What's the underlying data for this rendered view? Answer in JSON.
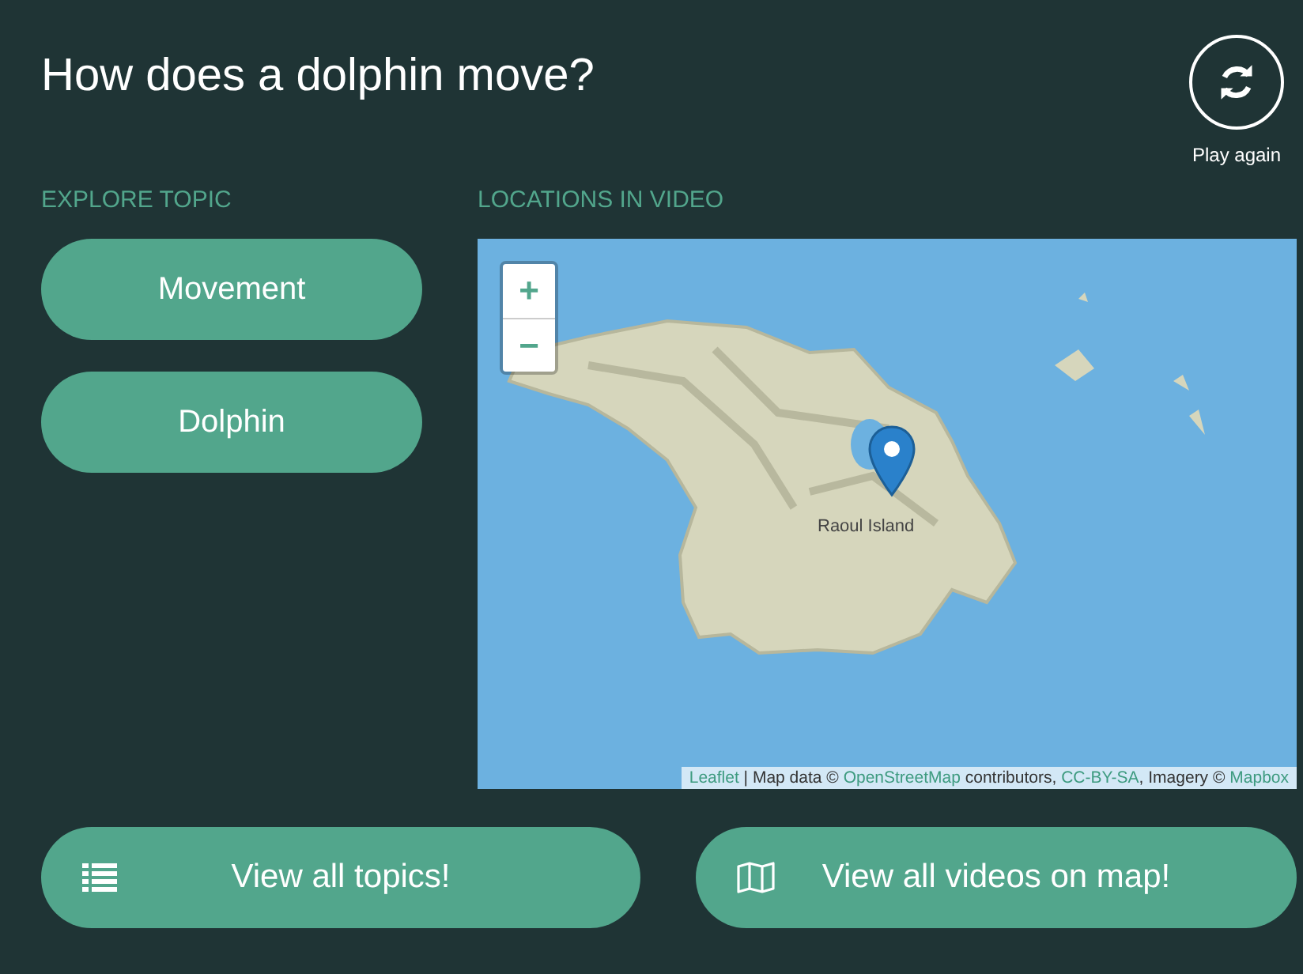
{
  "title": "How does a dolphin move?",
  "play_again": {
    "label": "Play again"
  },
  "explore": {
    "heading": "EXPLORE TOPIC",
    "topics": [
      {
        "label": "Movement"
      },
      {
        "label": "Dolphin"
      }
    ]
  },
  "map": {
    "heading": "LOCATIONS IN VIDEO",
    "zoom_in": "+",
    "zoom_out": "−",
    "place_label": "Raoul Island",
    "attribution": [
      {
        "kind": "link",
        "text": "Leaflet"
      },
      {
        "kind": "text",
        "text": " | Map data © "
      },
      {
        "kind": "link",
        "text": "OpenStreetMap"
      },
      {
        "kind": "text",
        "text": " contributors, "
      },
      {
        "kind": "link",
        "text": "CC-BY-SA"
      },
      {
        "kind": "text",
        "text": ", Imagery © "
      },
      {
        "kind": "link",
        "text": "Mapbox"
      }
    ]
  },
  "buttons": [
    {
      "kind": "list",
      "label": "View all topics!"
    },
    {
      "kind": "map",
      "label": "View all videos on map!"
    }
  ]
}
